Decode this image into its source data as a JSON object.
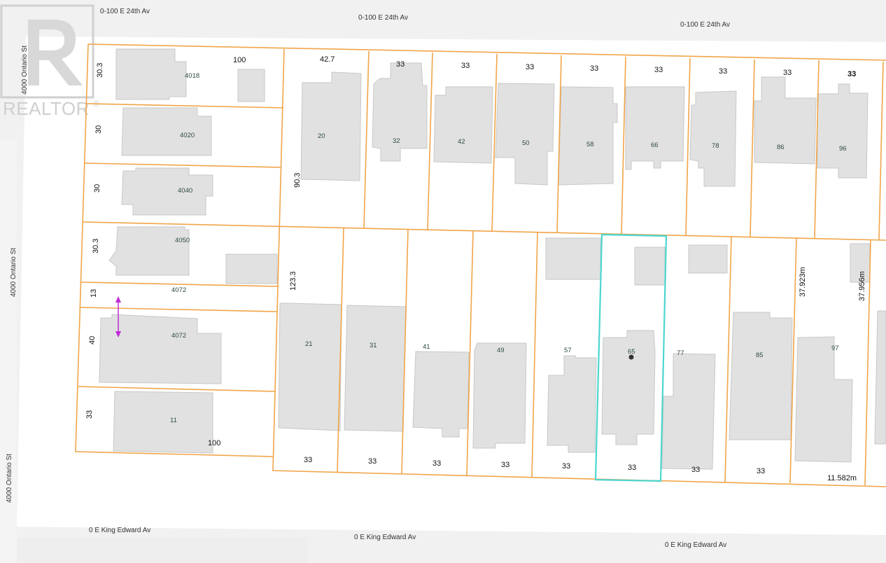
{
  "map": {
    "colors": {
      "background": "#ffffff",
      "street": "#f1f1f1",
      "parcel_line": "#f0a54a",
      "building": "#e1e1e1",
      "building_stroke": "#c8c8c8",
      "selected": "#4dd6cf",
      "measure_arrow": "#c02bd6",
      "logo": "#d0d0d0"
    },
    "logo": {
      "text": "REALTOR",
      "mark": "®",
      "icon": "realtor-r-logo"
    },
    "streets": {
      "north_1": "0-100 E 24th Av",
      "north_2": "0-100 E 24th Av",
      "north_3": "0-100 E 24th Av",
      "west_1": "4000 Ontario St",
      "west_2": "4000 Ontario St",
      "west_3": "4000 Ontario St",
      "south_1": "0 E King Edward Av",
      "south_2": "0 E King Edward Av",
      "south_3": "0 E King Edward Av"
    },
    "dimensions": {
      "west_30_3_a": "30.3",
      "w_100_top": "100",
      "west_30_a": "30",
      "west_30_b": "30",
      "west_30_3_b": "30.3",
      "west_13": "13",
      "west_40": "40",
      "west_33": "33",
      "w_100_bottom": "100",
      "top_42_7": "42.7",
      "left_90_3": "90.3",
      "left_123_3": "123.3",
      "n32": "33",
      "n42": "33",
      "n50": "33",
      "n58": "33",
      "n66": "33",
      "n78": "33",
      "n86": "33",
      "n96": "33",
      "s21": "33",
      "s31": "33",
      "s41": "33",
      "s49": "33",
      "s57": "33",
      "s65": "33",
      "s77": "33",
      "s85": "33",
      "m37_923": "37.923m",
      "m37_956": "37.956m",
      "m11_582": "11.582m"
    },
    "house_numbers": {
      "h4018": "4018",
      "h4020": "4020",
      "h4040": "4040",
      "h4050": "4050",
      "h4072_strip": "4072",
      "h4072": "4072",
      "h11": "11",
      "h20": "20",
      "h32": "32",
      "h42": "42",
      "h50": "50",
      "h58": "58",
      "h66": "66",
      "h78": "78",
      "h86": "86",
      "h96": "96",
      "h21": "21",
      "h31": "31",
      "h41": "41",
      "h49": "49",
      "h57": "57",
      "h65": "65",
      "h77": "77",
      "h85": "85",
      "h97": "97"
    }
  }
}
